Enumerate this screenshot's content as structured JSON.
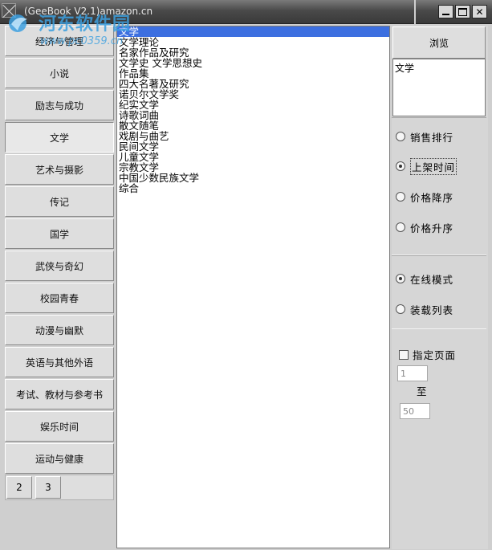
{
  "window": {
    "title": "(GeeBook V2.1)amazon.cn",
    "watermark_cn": "河东软件园",
    "watermark_url": "www.pc0359.cn"
  },
  "categories": [
    "经济与管理",
    "小说",
    "励志与成功",
    "文学",
    "艺术与摄影",
    "传记",
    "国学",
    "武侠与奇幻",
    "校园青春",
    "动漫与幽默",
    "英语与其他外语",
    "考试、教材与参考书",
    "娱乐时间",
    "运动与健康"
  ],
  "active_category": "文学",
  "pages": [
    "2",
    "3"
  ],
  "subcategories": [
    "文学",
    "文学理论",
    "名家作品及研究",
    "文学史 文学思想史",
    "作品集",
    "四大名著及研究",
    "诺贝尔文学奖",
    "纪实文学",
    "诗歌词曲",
    "散文随笔",
    "戏剧与曲艺",
    "民间文学",
    "儿童文学",
    "宗教文学",
    "中国少数民族文学",
    "综合"
  ],
  "right_panel": {
    "browse_label": "浏览",
    "selected_category": "文学",
    "sort_options": [
      "销售排行",
      "上架时间",
      "价格降序",
      "价格升序"
    ],
    "sort_selected": "上架时间",
    "mode_options": [
      "在线模式",
      "装载列表"
    ],
    "mode_selected": "在线模式",
    "page_range_label": "指定页面",
    "page_from": "1",
    "to_label": "至",
    "page_to": "50"
  },
  "colors": {
    "selection": "#3c6fe0",
    "background": "#cfcfcf"
  }
}
